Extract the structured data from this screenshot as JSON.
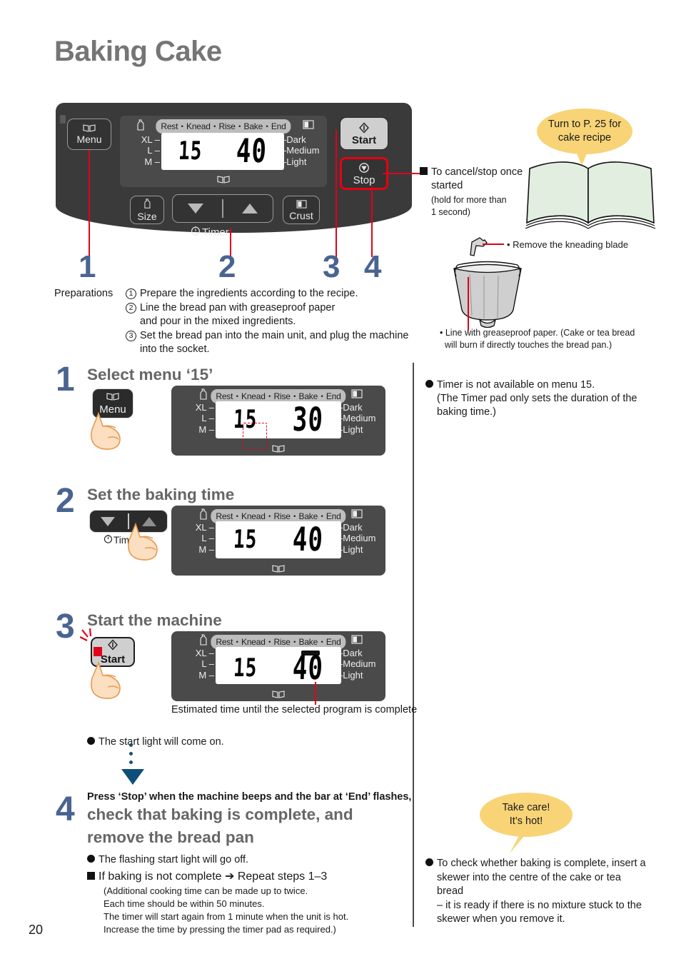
{
  "page": {
    "title": "Baking Cake",
    "number": "20"
  },
  "control_panel": {
    "menu_pad": {
      "label": "Menu",
      "icon": "book-icon"
    },
    "size_pad": {
      "label": "Size",
      "icon": "loaf-size-icon"
    },
    "crust_pad": {
      "label": "Crust",
      "icon": "crust-icon"
    },
    "timer_pad": {
      "caption": "Timer",
      "icon": "clock-icon",
      "down": "▼",
      "up": "▲"
    },
    "start_pad": {
      "label": "Start",
      "icon": "start-diamond-icon"
    },
    "stop_pad": {
      "label": "Stop",
      "icon": "stop-circle-icon"
    },
    "lcd": {
      "phase": "Rest・Knead・Rise・Bake・End",
      "menu_number": "15",
      "time": "40",
      "sizes": [
        "XL",
        "L",
        "M"
      ],
      "crusts": [
        "Dark",
        "Medium",
        "Light"
      ]
    },
    "index_numbers": [
      "1",
      "2",
      "3",
      "4"
    ]
  },
  "preparations": {
    "label": "Preparations",
    "items": [
      {
        "num": "1",
        "lines": [
          "Prepare the ingredients according to the recipe."
        ]
      },
      {
        "num": "2",
        "lines": [
          "Line the bread pan with greaseproof paper",
          "and pour in the mixed ingredients."
        ]
      },
      {
        "num": "3",
        "lines": [
          "Set the bread pan into the main unit, and plug the machine",
          "into the socket."
        ]
      }
    ]
  },
  "callouts": {
    "cancel_stop": {
      "heading_line1": "To cancel/stop once",
      "heading_line2": "started",
      "sub_line1": "(hold for more than",
      "sub_line2": "1 second)"
    },
    "recipe_bubble": {
      "line1": "Turn to P. 25 for",
      "line2": "cake recipe"
    },
    "kneading_blade": "• Remove the kneading blade",
    "greaseproof": {
      "line1": "• Line with greaseproof paper. (Cake or tea bread",
      "line2": "will burn if directly touches the bread pan.)"
    },
    "take_care_bubble": {
      "line1": "Take care!",
      "line2": "It’s hot!"
    }
  },
  "steps": [
    {
      "num": "1",
      "title": "Select menu ‘15’",
      "pad_label": "Menu",
      "lcd": {
        "phase": "Rest・Knead・Rise・Bake・End",
        "menu_number": "15",
        "time": "30",
        "sizes": [
          "XL",
          "L",
          "M"
        ],
        "crusts": [
          "Dark",
          "Medium",
          "Light"
        ]
      }
    },
    {
      "num": "2",
      "title": "Set the baking time",
      "pad_caption": "Timer",
      "lcd": {
        "phase": "Rest・Knead・Rise・Bake・End",
        "menu_number": "15",
        "time": "40",
        "sizes": [
          "XL",
          "L",
          "M"
        ],
        "crusts": [
          "Dark",
          "Medium",
          "Light"
        ]
      }
    },
    {
      "num": "3",
      "title": "Start the machine",
      "pad_label": "Start",
      "lcd": {
        "phase": "Rest・Knead・Rise・Bake・End",
        "menu_number": "15",
        "time": "40",
        "sizes": [
          "XL",
          "L",
          "M"
        ],
        "crusts": [
          "Dark",
          "Medium",
          "Light"
        ]
      },
      "caption": "Estimated time until the selected program is complete",
      "bullet": "The start light will come on."
    },
    {
      "num": "4",
      "title_small": "Press ‘Stop’ when the machine beeps and the bar at ‘End’ flashes,",
      "title_line1": "check that baking is complete, and",
      "title_line2": "remove the bread pan",
      "bullet": "The flashing start light will go off.",
      "square_note": "If baking is not complete ➔ Repeat steps 1–3",
      "sub_lines": [
        "(Additional cooking time can be made up to twice.",
        "Each time should be within 50 minutes.",
        "The timer will start again from 1 minute when the unit is hot.",
        "Increase the time by pressing the timer pad as required.)"
      ]
    }
  ],
  "side_notes": {
    "timer_note": {
      "line1": "Timer is not available on menu 15.",
      "line2": "(The Timer pad only sets the duration of the",
      "line3": "baking time.)"
    },
    "skewer_note": {
      "line1": "To check whether baking is complete, insert a",
      "line2": "skewer into the centre of the cake or tea bread",
      "line3": "– it is ready if there is no mixture stuck to the",
      "line4": "skewer when you remove it."
    }
  },
  "colors": {
    "accent_blue": "#4a6491",
    "red": "#e2001a",
    "bubble_yellow": "#f8d477",
    "panel_dark": "#3a3a3a",
    "title_gray": "#757575"
  }
}
